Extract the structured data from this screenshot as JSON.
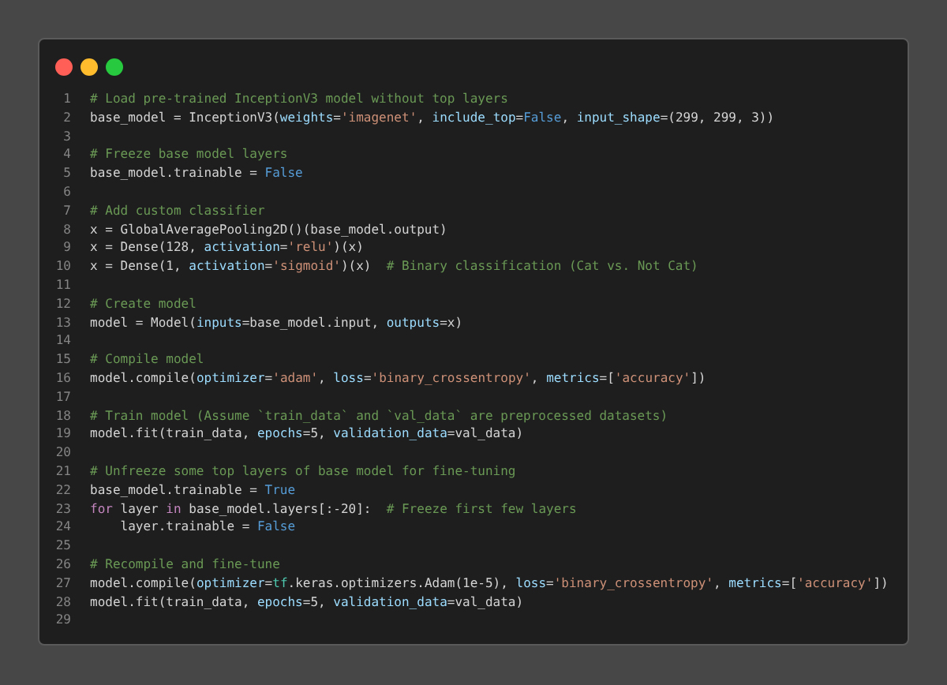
{
  "window": {
    "controls": [
      {
        "color": "#ff5f56"
      },
      {
        "color": "#ffbd2e"
      },
      {
        "color": "#27c93f"
      }
    ]
  },
  "code": {
    "lines": [
      {
        "number": "1",
        "tokens": [
          {
            "kind": "comment",
            "text": "# Load pre-trained InceptionV3 model without top layers"
          }
        ]
      },
      {
        "number": "2",
        "tokens": [
          {
            "kind": "plain",
            "text": "base_model = InceptionV3("
          },
          {
            "kind": "arg",
            "text": "weights"
          },
          {
            "kind": "plain",
            "text": "="
          },
          {
            "kind": "string",
            "text": "'imagenet'"
          },
          {
            "kind": "plain",
            "text": ", "
          },
          {
            "kind": "arg",
            "text": "include_top"
          },
          {
            "kind": "plain",
            "text": "="
          },
          {
            "kind": "constant",
            "text": "False"
          },
          {
            "kind": "plain",
            "text": ", "
          },
          {
            "kind": "arg",
            "text": "input_shape"
          },
          {
            "kind": "plain",
            "text": "=(299, 299, 3))"
          }
        ]
      },
      {
        "number": "3"
      },
      {
        "number": "4",
        "tokens": [
          {
            "kind": "comment",
            "text": "# Freeze base model layers"
          }
        ]
      },
      {
        "number": "5",
        "tokens": [
          {
            "kind": "plain",
            "text": "base_model.trainable = "
          },
          {
            "kind": "constant",
            "text": "False"
          }
        ]
      },
      {
        "number": "6"
      },
      {
        "number": "7",
        "tokens": [
          {
            "kind": "comment",
            "text": "# Add custom classifier"
          }
        ]
      },
      {
        "number": "8",
        "tokens": [
          {
            "kind": "plain",
            "text": "x = GlobalAveragePooling2D()(base_model.output)"
          }
        ]
      },
      {
        "number": "9",
        "tokens": [
          {
            "kind": "plain",
            "text": "x = Dense(128, "
          },
          {
            "kind": "arg",
            "text": "activation"
          },
          {
            "kind": "plain",
            "text": "="
          },
          {
            "kind": "string",
            "text": "'relu'"
          },
          {
            "kind": "plain",
            "text": ")(x)"
          }
        ]
      },
      {
        "number": "10",
        "tokens": [
          {
            "kind": "plain",
            "text": "x = Dense(1, "
          },
          {
            "kind": "arg",
            "text": "activation"
          },
          {
            "kind": "plain",
            "text": "="
          },
          {
            "kind": "string",
            "text": "'sigmoid'"
          },
          {
            "kind": "plain",
            "text": ")(x)  "
          },
          {
            "kind": "comment",
            "text": "# Binary classification (Cat vs. Not Cat)"
          }
        ]
      },
      {
        "number": "11"
      },
      {
        "number": "12",
        "tokens": [
          {
            "kind": "comment",
            "text": "# Create model"
          }
        ]
      },
      {
        "number": "13",
        "tokens": [
          {
            "kind": "plain",
            "text": "model = Model("
          },
          {
            "kind": "arg",
            "text": "inputs"
          },
          {
            "kind": "plain",
            "text": "=base_model.input, "
          },
          {
            "kind": "arg",
            "text": "outputs"
          },
          {
            "kind": "plain",
            "text": "=x)"
          }
        ]
      },
      {
        "number": "14"
      },
      {
        "number": "15",
        "tokens": [
          {
            "kind": "comment",
            "text": "# Compile model"
          }
        ]
      },
      {
        "number": "16",
        "tokens": [
          {
            "kind": "plain",
            "text": "model.compile("
          },
          {
            "kind": "arg",
            "text": "optimizer"
          },
          {
            "kind": "plain",
            "text": "="
          },
          {
            "kind": "string",
            "text": "'adam'"
          },
          {
            "kind": "plain",
            "text": ", "
          },
          {
            "kind": "arg",
            "text": "loss"
          },
          {
            "kind": "plain",
            "text": "="
          },
          {
            "kind": "string",
            "text": "'binary_crossentropy'"
          },
          {
            "kind": "plain",
            "text": ", "
          },
          {
            "kind": "arg",
            "text": "metrics"
          },
          {
            "kind": "plain",
            "text": "=["
          },
          {
            "kind": "string",
            "text": "'accuracy'"
          },
          {
            "kind": "plain",
            "text": "])"
          }
        ]
      },
      {
        "number": "17"
      },
      {
        "number": "18",
        "tokens": [
          {
            "kind": "comment",
            "text": "# Train model (Assume `train_data` and `val_data` are preprocessed datasets)"
          }
        ]
      },
      {
        "number": "19",
        "tokens": [
          {
            "kind": "plain",
            "text": "model.fit(train_data, "
          },
          {
            "kind": "arg",
            "text": "epochs"
          },
          {
            "kind": "plain",
            "text": "=5, "
          },
          {
            "kind": "arg",
            "text": "validation_data"
          },
          {
            "kind": "plain",
            "text": "=val_data)"
          }
        ]
      },
      {
        "number": "20"
      },
      {
        "number": "21",
        "tokens": [
          {
            "kind": "comment",
            "text": "# Unfreeze some top layers of base model for fine-tuning"
          }
        ]
      },
      {
        "number": "22",
        "tokens": [
          {
            "kind": "plain",
            "text": "base_model.trainable = "
          },
          {
            "kind": "constant",
            "text": "True"
          }
        ]
      },
      {
        "number": "23",
        "tokens": [
          {
            "kind": "keyword",
            "text": "for"
          },
          {
            "kind": "plain",
            "text": " layer "
          },
          {
            "kind": "keyword",
            "text": "in"
          },
          {
            "kind": "plain",
            "text": " base_model.layers[:-20]:  "
          },
          {
            "kind": "comment",
            "text": "# Freeze first few layers"
          }
        ]
      },
      {
        "number": "24",
        "tokens": [
          {
            "kind": "plain",
            "text": "    layer.trainable = "
          },
          {
            "kind": "constant",
            "text": "False"
          }
        ]
      },
      {
        "number": "25"
      },
      {
        "number": "26",
        "tokens": [
          {
            "kind": "comment",
            "text": "# Recompile and fine-tune"
          }
        ]
      },
      {
        "number": "27",
        "tokens": [
          {
            "kind": "plain",
            "text": "model.compile("
          },
          {
            "kind": "arg",
            "text": "optimizer"
          },
          {
            "kind": "plain",
            "text": "="
          },
          {
            "kind": "module",
            "text": "tf"
          },
          {
            "kind": "plain",
            "text": ".keras.optimizers.Adam(1e-5), "
          },
          {
            "kind": "arg",
            "text": "loss"
          },
          {
            "kind": "plain",
            "text": "="
          },
          {
            "kind": "string",
            "text": "'binary_crossentropy'"
          },
          {
            "kind": "plain",
            "text": ", "
          },
          {
            "kind": "arg",
            "text": "metrics"
          },
          {
            "kind": "plain",
            "text": "=["
          },
          {
            "kind": "string",
            "text": "'accuracy'"
          },
          {
            "kind": "plain",
            "text": "])"
          }
        ]
      },
      {
        "number": "28",
        "tokens": [
          {
            "kind": "plain",
            "text": "model.fit(train_data, "
          },
          {
            "kind": "arg",
            "text": "epochs"
          },
          {
            "kind": "plain",
            "text": "=5, "
          },
          {
            "kind": "arg",
            "text": "validation_data"
          },
          {
            "kind": "plain",
            "text": "=val_data)"
          }
        ]
      },
      {
        "number": "29"
      }
    ]
  }
}
